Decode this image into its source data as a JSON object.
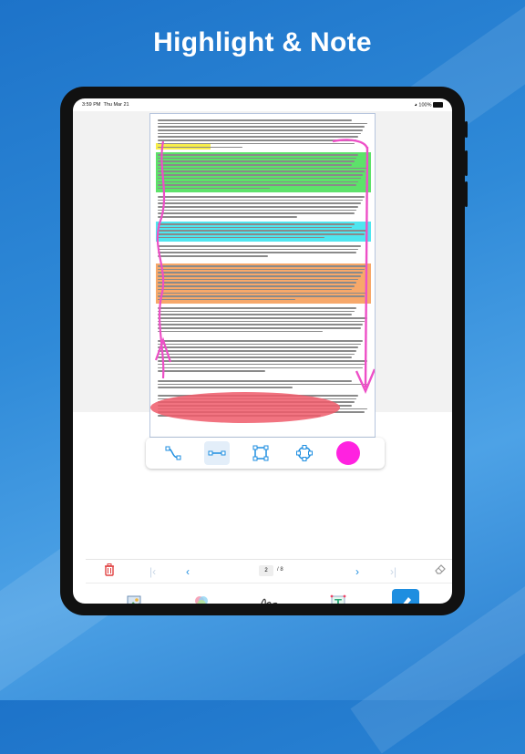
{
  "headline": "Highlight & Note",
  "status_bar": {
    "time": "3:59 PM",
    "date": "Thu Mar 21",
    "battery": "100%"
  },
  "document": {
    "highlight_colors": {
      "yellow": "#f7ee4a",
      "green": "#5de26a",
      "cyan": "#4fe6f0",
      "orange": "#f7a86a",
      "red": "#ee5a6a"
    },
    "ink_color": "#ee4fc7"
  },
  "shape_tools": [
    {
      "name": "curve-tool-icon",
      "selected": false
    },
    {
      "name": "line-tool-icon",
      "selected": true
    },
    {
      "name": "rectangle-tool-icon",
      "selected": false
    },
    {
      "name": "ellipse-tool-icon",
      "selected": false
    },
    {
      "name": "color-picker-swatch",
      "color": "#ff22e0"
    }
  ],
  "navigation": {
    "current_page": "2",
    "total_pages": "/ 8"
  },
  "toolbar": [
    {
      "name": "image-crop-icon"
    },
    {
      "name": "color-blend-icon"
    },
    {
      "name": "signature-icon"
    },
    {
      "name": "text-tool-icon"
    },
    {
      "name": "highlighter-icon",
      "selected": true
    }
  ],
  "accent_color": "#1e8ee0"
}
